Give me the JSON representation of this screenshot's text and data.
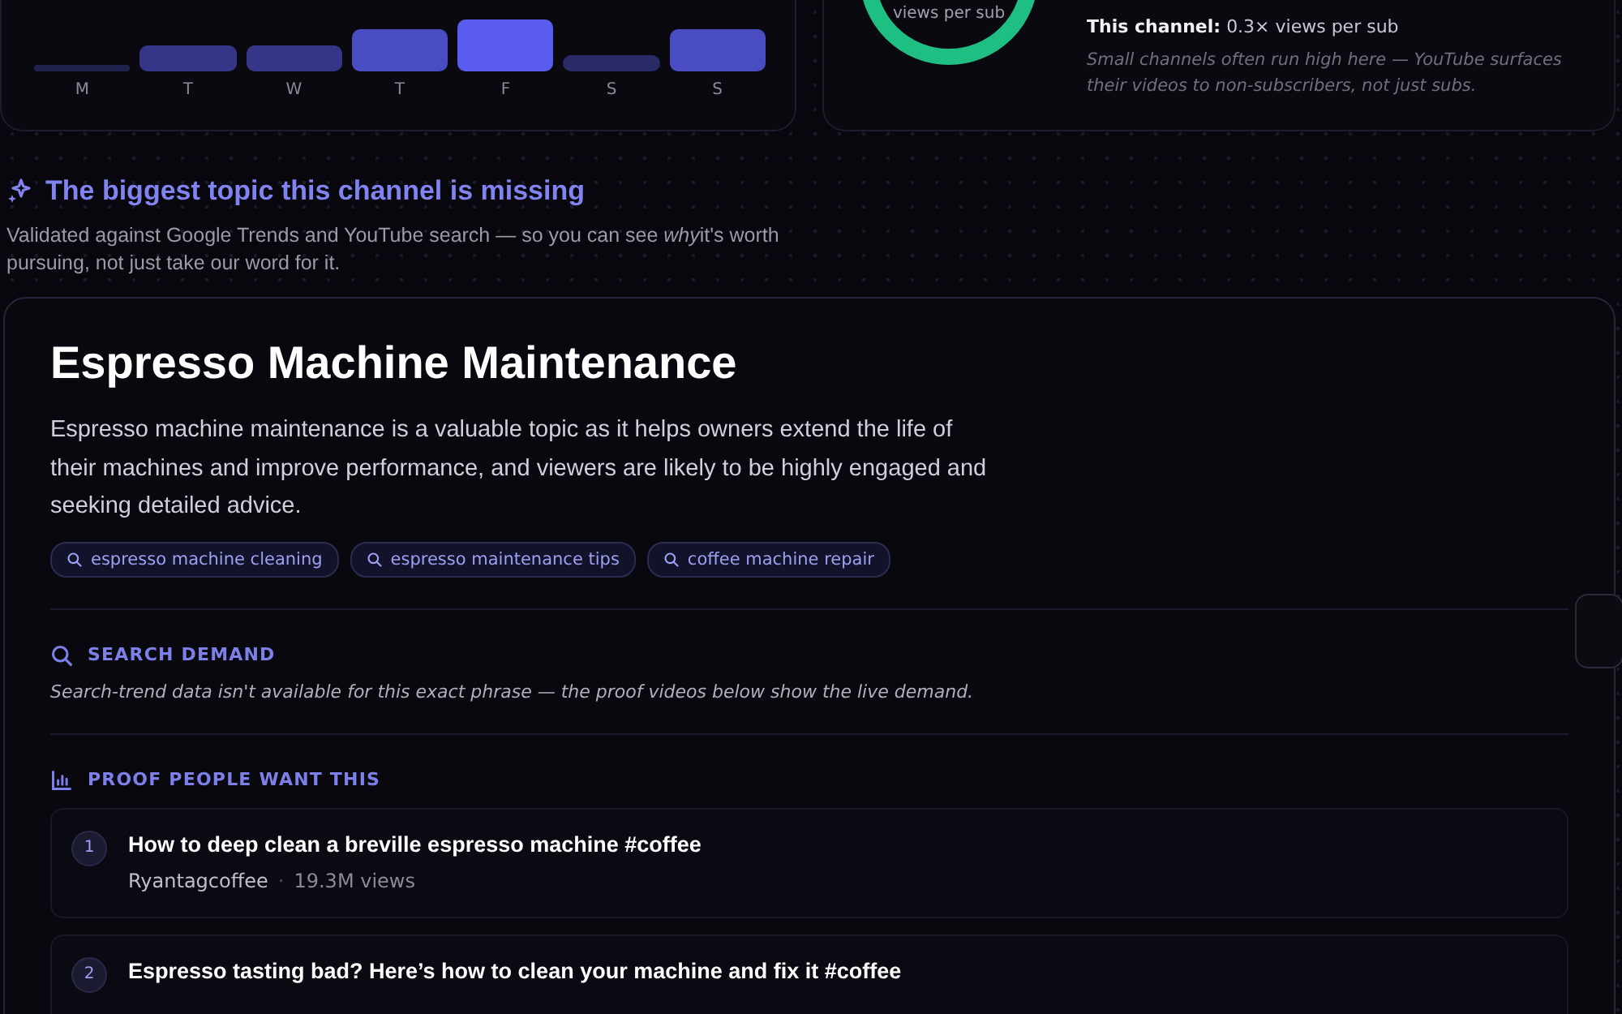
{
  "upload_days": {
    "bars": [
      {
        "label": "M"
      },
      {
        "label": "T"
      },
      {
        "label": "W"
      },
      {
        "label": "T"
      },
      {
        "label": "F"
      },
      {
        "label": "S"
      },
      {
        "label": "S"
      }
    ]
  },
  "views_ratio": {
    "ring_caption": "views per sub",
    "this_channel_label": "This channel:",
    "this_channel_value": "0.3× views per sub",
    "note": "Small channels often run high here — YouTube surfaces their videos to non-subscribers, not just subs."
  },
  "missing_topic": {
    "heading": "The biggest topic this channel is missing",
    "intro": {
      "before": "Validated against Google Trends and YouTube search — so you can see ",
      "emphasis": "why",
      "after": "it's worth pursuing, not just take our word for it."
    },
    "title": "Espresso Machine Maintenance",
    "description": "Espresso machine maintenance is a valuable topic as it helps owners extend the life of their machines and improve performance, and viewers are likely to be highly engaged and seeking detailed advice.",
    "keywords": [
      "espresso machine cleaning",
      "espresso maintenance tips",
      "coffee machine repair"
    ],
    "search_demand": {
      "heading": "SEARCH DEMAND",
      "note": "Search-trend data isn't available for this exact phrase — the proof videos below show the live demand."
    },
    "proof": {
      "heading": "PROOF PEOPLE WANT THIS",
      "videos": [
        {
          "rank": "1",
          "title": "How to deep clean a breville espresso machine #coffee",
          "channel": "Ryantagcoffee",
          "separator": "·",
          "views": "19.3M views"
        },
        {
          "rank": "2",
          "title": "Espresso tasting bad? Here’s how to clean your machine and fix it #coffee"
        }
      ]
    }
  }
}
